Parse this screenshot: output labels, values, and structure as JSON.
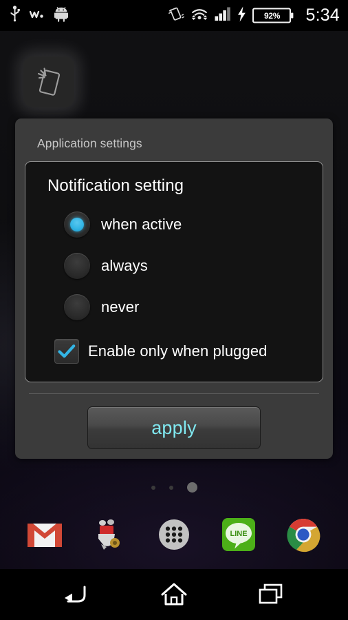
{
  "status_bar": {
    "left_icons": [
      {
        "name": "usb-icon",
        "label": "USB"
      },
      {
        "name": "walkman-icon",
        "label": "Walkman"
      },
      {
        "name": "android-robot-icon",
        "label": "Android"
      }
    ],
    "right_icons": [
      {
        "name": "vibrate-icon",
        "label": "Vibrate"
      },
      {
        "name": "wifi-icon",
        "label": "Wi-Fi"
      },
      {
        "name": "cellular-signal-icon",
        "label": "Signal"
      },
      {
        "name": "charging-bolt-icon",
        "label": "Charging"
      }
    ],
    "battery_percent": "92%",
    "clock": "5:34"
  },
  "home": {
    "widget_icon_name": "shake-phone-widget-icon",
    "page_indicator": {
      "count": 3,
      "active_index": 2
    }
  },
  "dialog": {
    "title": "Application settings",
    "panel": {
      "heading": "Notification setting",
      "radio_group_name": "notification-setting",
      "options": [
        {
          "label": "when active",
          "selected": true
        },
        {
          "label": "always",
          "selected": false
        },
        {
          "label": "never",
          "selected": false
        }
      ],
      "checkbox": {
        "label": "Enable only when plugged",
        "checked": true
      }
    },
    "apply_label": "apply",
    "accent_color": "#33b5e5",
    "apply_text_color": "#80e8f0"
  },
  "dock": {
    "items": [
      {
        "name": "gmail-icon",
        "label": "Gmail"
      },
      {
        "name": "scooter-app-icon",
        "label": "Scooter"
      },
      {
        "name": "app-drawer-icon",
        "label": "Apps"
      },
      {
        "name": "line-icon",
        "label": "LINE"
      },
      {
        "name": "chrome-icon",
        "label": "Chrome"
      }
    ]
  },
  "nav_bar": {
    "buttons": [
      {
        "name": "back-button",
        "label": "Back"
      },
      {
        "name": "home-button",
        "label": "Home"
      },
      {
        "name": "recents-button",
        "label": "Recents"
      }
    ]
  }
}
